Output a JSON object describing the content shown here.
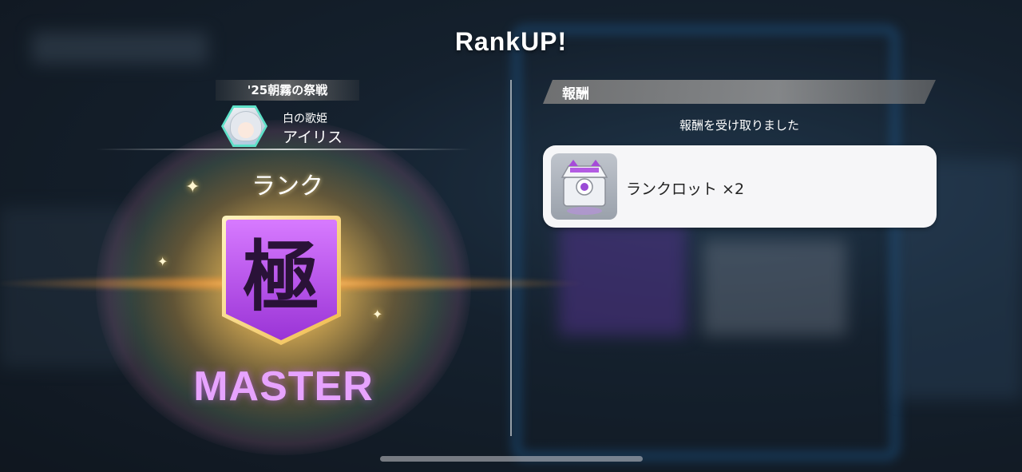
{
  "title": "RankUP!",
  "left_panel": {
    "event_name": "'25朝霧の祭戦",
    "character": {
      "subtitle": "白の歌姫",
      "name": "アイリス",
      "avatar_icon": "character-portrait"
    },
    "rank_label": "ランク",
    "rank_kanji": "極",
    "rank_name": "MASTER",
    "rank_color": "#b34ee0"
  },
  "right_panel": {
    "header": "報酬",
    "message": "報酬を受け取りました",
    "rewards": [
      {
        "icon": "rank-lot-chest-icon",
        "label": "ランクロット ×2"
      }
    ]
  }
}
